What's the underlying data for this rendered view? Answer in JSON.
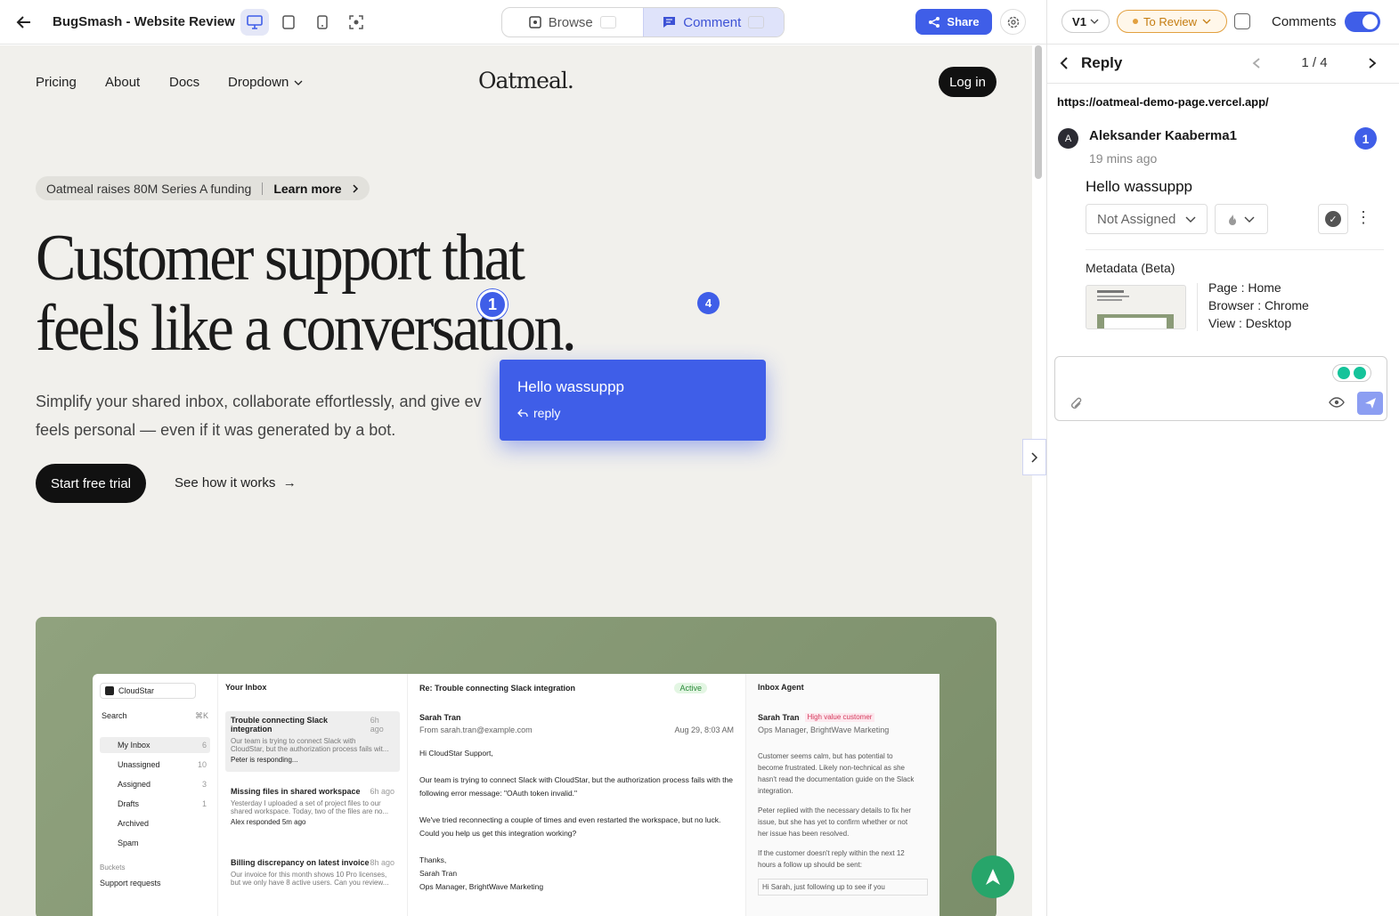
{
  "topbar": {
    "title": "BugSmash - Website Review",
    "modes": {
      "browse": "Browse",
      "comment": "Comment"
    },
    "share": "Share"
  },
  "site": {
    "nav": [
      "Pricing",
      "About",
      "Docs",
      "Dropdown"
    ],
    "logo": "Oatmeal.",
    "login": "Log in",
    "announcement": "Oatmeal raises 80M Series A funding",
    "announcement_link": "Learn more",
    "hero_line1": "Customer support that",
    "hero_line2": "feels like a conversation.",
    "subtitle": "Simplify your shared inbox, collaborate effortlessly, and give ev",
    "subtitle2": "feels personal — even if it was generated by a bot.",
    "cta_primary": "Start free trial",
    "cta_secondary": "See how it works"
  },
  "pins": {
    "first": "1",
    "second": "4"
  },
  "popup": {
    "text": "Hello wassuppp",
    "reply": "reply"
  },
  "mock": {
    "org": "CloudStar",
    "search": "Search",
    "search_kbd": "⌘K",
    "menu": [
      {
        "label": "My Inbox",
        "count": "6"
      },
      {
        "label": "Unassigned",
        "count": "10"
      },
      {
        "label": "Assigned",
        "count": "3"
      },
      {
        "label": "Drafts",
        "count": "1"
      },
      {
        "label": "Archived",
        "count": ""
      },
      {
        "label": "Spam",
        "count": ""
      }
    ],
    "buckets": "Buckets",
    "support": "Support requests",
    "inbox_title": "Your Inbox",
    "threads": [
      {
        "title": "Trouble connecting Slack integration",
        "time": "6h ago",
        "line1": "Our team is trying to connect Slack with",
        "line2": "CloudStar, but the authorization process fails wit...",
        "foot": "Peter is responding..."
      },
      {
        "title": "Missing files in shared workspace",
        "time": "6h ago",
        "line1": "Yesterday I uploaded a set of project files to our",
        "line2": "shared workspace. Today, two of the files are no...",
        "foot": "Alex responded 5m ago"
      },
      {
        "title": "Billing discrepancy on latest invoice",
        "time": "8h ago",
        "line1": "Our invoice for this month shows 10 Pro licenses,",
        "line2": "but we only have 8 active users. Can you review...",
        "foot": ""
      }
    ],
    "email_subject": "Re: Trouble connecting Slack integration",
    "email_status": "Active",
    "email_from_name": "Sarah Tran",
    "email_from": "From  sarah.tran@example.com",
    "email_date": "Aug 29, 8:03 AM",
    "email_body": [
      "Hi CloudStar Support,",
      "Our team is trying to connect Slack with CloudStar, but the authorization process fails with the",
      "following error message: \"OAuth token invalid.\"",
      "We've tried reconnecting a couple of times and even restarted the workspace, but no luck.",
      "Could you help us get this integration working?",
      "Thanks,",
      "Sarah Tran",
      "Ops Manager, BrightWave Marketing"
    ],
    "agent_title": "Inbox Agent",
    "agent_name": "Sarah Tran",
    "agent_tag": "High value customer",
    "agent_role": "Ops Manager, BrightWave Marketing",
    "agent_notes": [
      "Customer seems calm, but has potential to",
      "become frustrated. Likely non-technical as she",
      "hasn't read the documentation guide on the Slack",
      "integration.",
      "Peter replied with the necessary details to fix her",
      "issue, but she has yet to confirm whether or not",
      "her issue has been resolved.",
      "If the customer doesn't reply within the next 12",
      "hours a follow up should be sent:",
      "Hi Sarah, just following up to see if you"
    ]
  },
  "panel": {
    "version": "V1",
    "status": "To Review",
    "comments_label": "Comments",
    "reply_title": "Reply",
    "pager": "1 / 4",
    "url": "https://oatmeal-demo-page.vercel.app/",
    "avatar": "A",
    "author": "Aleksander Kaaberma1",
    "number": "1",
    "time": "19 mins ago",
    "message": "Hello wassuppp",
    "assign": "Not Assigned",
    "metadata_title": "Metadata (Beta)",
    "meta_page": "Page : Home",
    "meta_browser": "Browser : Chrome",
    "meta_view": "View : Desktop"
  }
}
